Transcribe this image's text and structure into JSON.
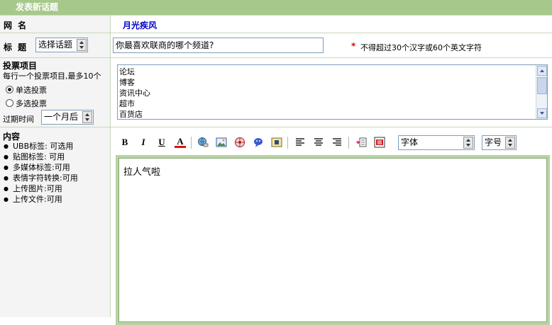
{
  "header": {
    "title": "发表新话题"
  },
  "username_row": {
    "label": "网 名",
    "value": "月光疾风"
  },
  "title_row": {
    "label": "标 题",
    "topic_select": "选择话题",
    "subject_value": "你最喜欢联商的哪个频道?",
    "required_mark": "*",
    "hint": "不得超过30个汉字或60个英文字符"
  },
  "poll": {
    "heading": "投票项目",
    "desc": "每行一个投票项目,最多10个",
    "single_label": "单选投票",
    "multi_label": "多选投票",
    "expire_label": "过期时间",
    "expire_value": "一个月后",
    "options": [
      "论坛",
      "博客",
      "资讯中心",
      "超市",
      "百货店"
    ]
  },
  "content": {
    "heading": "内容",
    "rules": [
      "UBB标签: 可选用",
      "贴图标签: 可用",
      "多媒体标签:可用",
      "表情字符转换:可用",
      "上传图片:可用",
      "上传文件:可用"
    ],
    "bullet": "●",
    "body_text": "拉人气啦"
  },
  "toolbar": {
    "bold": "B",
    "italic": "I",
    "underline": "U",
    "font_color": "A",
    "font_select": "字体",
    "size_select": "字号"
  },
  "colors": {
    "header_bg": "#a6c98b",
    "editor_border": "#b7d3a2",
    "accent_blue": "#0000cc"
  }
}
